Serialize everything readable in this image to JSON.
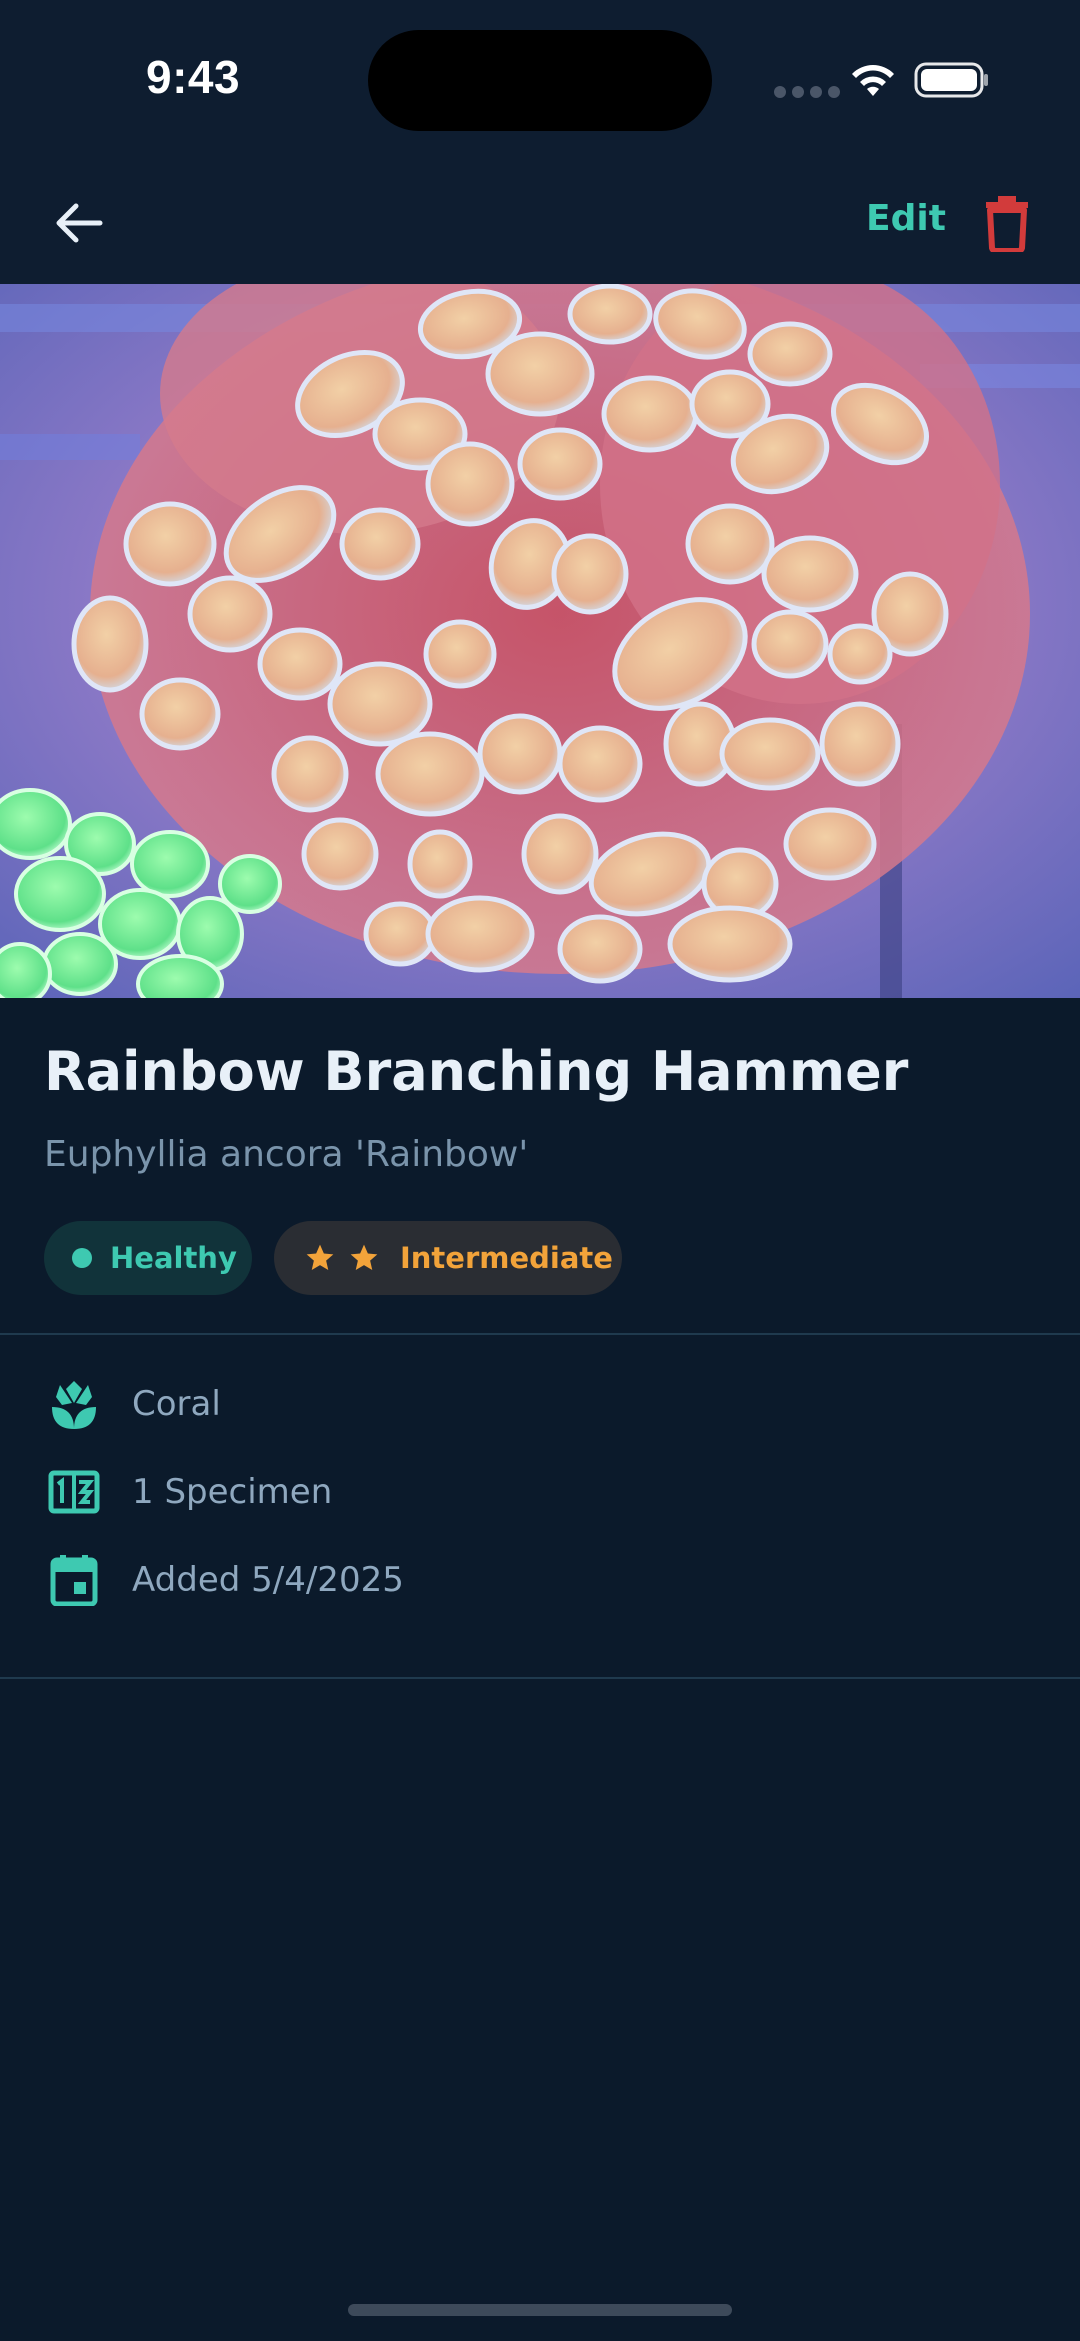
{
  "status_bar": {
    "time": "9:43"
  },
  "nav": {
    "back_icon": "arrow-left-icon",
    "edit_label": "Edit",
    "delete_icon": "trash-icon"
  },
  "item": {
    "name": "Rainbow Branching Hammer",
    "scientific_name": "Euphyllia ancora 'Rainbow'",
    "health": "Healthy",
    "difficulty": "Intermediate",
    "difficulty_stars": 2,
    "details": [
      {
        "icon": "coral-icon",
        "label": "Coral"
      },
      {
        "icon": "counter-icon",
        "label": "1 Specimen"
      },
      {
        "icon": "calendar-icon",
        "label": "Added 5/4/2025"
      }
    ]
  },
  "colors": {
    "background": "#0b1a2b",
    "accent": "#3ec9b1",
    "danger": "#d23b3b",
    "warning": "#f2a33a"
  }
}
